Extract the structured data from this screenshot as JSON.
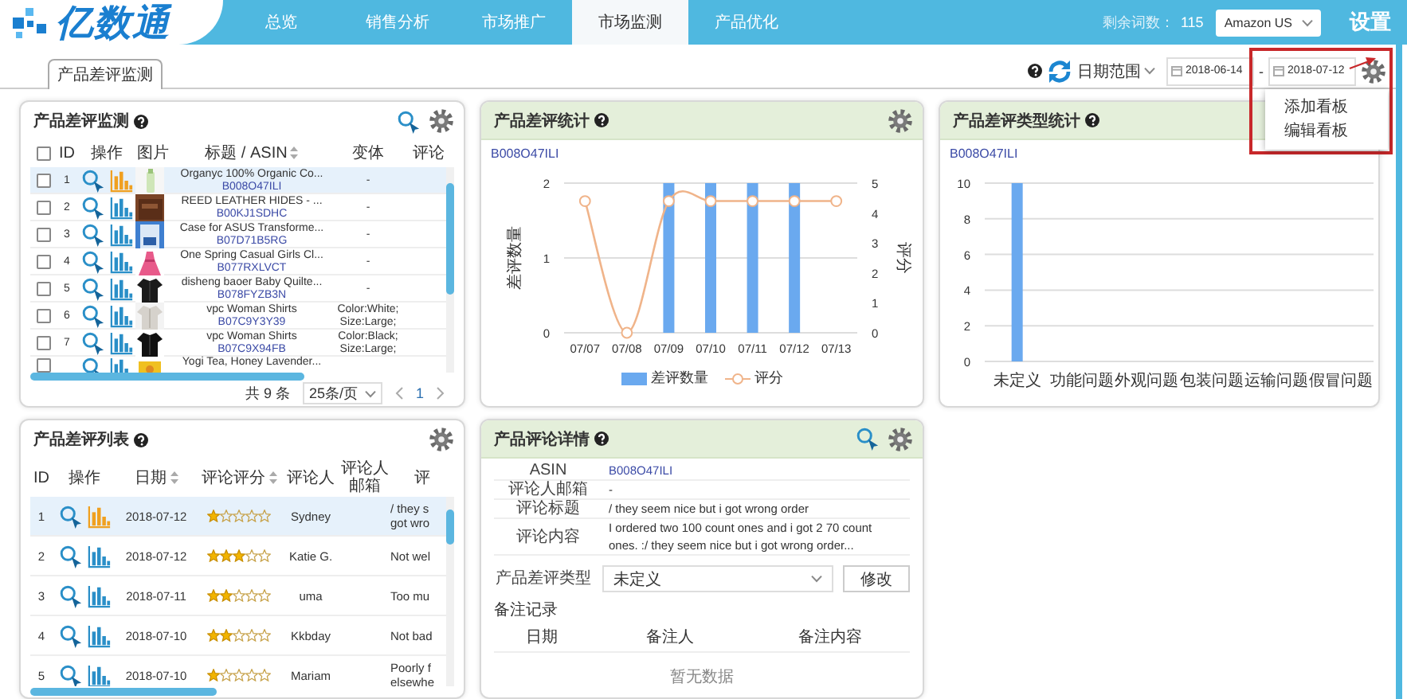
{
  "header": {
    "logo": "亿数通",
    "nav": [
      {
        "label": "总览",
        "selected": false
      },
      {
        "label": "销售分析",
        "selected": false
      },
      {
        "label": "市场推广",
        "selected": false
      },
      {
        "label": "市场监测",
        "selected": true
      },
      {
        "label": "产品优化",
        "selected": false
      }
    ],
    "quota_label": "剩余词数：",
    "quota_value": "115",
    "marketplace": "Amazon US",
    "settings": "设置"
  },
  "toolbar": {
    "tabs": [
      {
        "label": "产品差评监测",
        "selected": true
      }
    ],
    "date_range": "日期范围",
    "start_date": "2018-06-14",
    "separator": "-",
    "end_date": "2018-07-12",
    "menu": {
      "expanded": true,
      "items": [
        "添加看板",
        "编辑看板"
      ]
    }
  },
  "product_monitor": {
    "title": "产品差评监测",
    "all_checked": false,
    "columns": [
      {
        "label": "ID",
        "sortable": false
      },
      {
        "label": "操作",
        "sortable": false
      },
      {
        "label": "图片",
        "sortable": false
      },
      {
        "label": "标题 / ASIN",
        "sortable": true
      },
      {
        "label": "变体",
        "sortable": false
      },
      {
        "label": "评论",
        "sortable": false
      }
    ],
    "rows": [
      {
        "id": "1",
        "title": "Organyc 100% Organic Co...",
        "asin": "B008O47ILI",
        "variant": "-",
        "checked": false,
        "selected": true
      },
      {
        "id": "2",
        "title": "REED LEATHER HIDES - ...",
        "asin": "B00KJ1SDHC",
        "variant": "-",
        "checked": false,
        "selected": false
      },
      {
        "id": "3",
        "title": "Case for ASUS Transforme...",
        "asin": "B07D71B5RG",
        "variant": "-",
        "checked": false,
        "selected": false
      },
      {
        "id": "4",
        "title": "One Spring Casual Girls Cl...",
        "asin": "B077RXLVCT",
        "variant": "-",
        "checked": false,
        "selected": false
      },
      {
        "id": "5",
        "title": "disheng baoer Baby Quilte...",
        "asin": "B078FYZB3N",
        "variant": "-",
        "checked": false,
        "selected": false
      },
      {
        "id": "6",
        "title": "vpc Woman Shirts",
        "asin": "B07C9Y3Y39",
        "variant": "Color:White; Size:Large;",
        "checked": false,
        "selected": false
      },
      {
        "id": "7",
        "title": "vpc Woman Shirts",
        "asin": "B07C9X94FB",
        "variant": "Color:Black; Size:Large;",
        "checked": false,
        "selected": false
      },
      {
        "title": "Yogi Tea, Honey Lavender...",
        "checked": false,
        "selected": false
      }
    ],
    "total": "共 9 条",
    "page_size": "25条/页",
    "page": "1"
  },
  "review_stats": {
    "title": "产品差评统计",
    "asin": "B008O47ILI",
    "chart_data": {
      "type": "bar",
      "ylabel": "差评数量",
      "y2label": "评分",
      "categories": [
        "07/07",
        "07/08",
        "07/09",
        "07/10",
        "07/11",
        "07/12",
        "07/13"
      ],
      "series": [
        {
          "name": "差评数量",
          "color": "#6aa9ef",
          "values": [
            0,
            0,
            2,
            2,
            2,
            2,
            0
          ]
        },
        {
          "name": "评分",
          "type": "line",
          "axis": "y2",
          "marker": true,
          "color": "#f0b48a",
          "values": [
            4.4,
            0,
            4.4,
            4.4,
            4.4,
            4.4,
            4.4
          ]
        }
      ],
      "ylim": [
        0,
        2
      ],
      "yticks": [
        {
          "value": 0,
          "label": "0"
        },
        {
          "value": 1,
          "label": "1"
        },
        {
          "value": 2,
          "label": "2"
        }
      ],
      "y2lim": [
        0,
        5
      ],
      "y2ticks": [
        {
          "value": 0,
          "label": "0"
        },
        {
          "value": 1,
          "label": "1"
        },
        {
          "value": 2,
          "label": "2"
        },
        {
          "value": 3,
          "label": "3"
        },
        {
          "value": 4,
          "label": "4"
        },
        {
          "value": 5,
          "label": "5"
        }
      ],
      "grid": true,
      "legend": "bottom"
    }
  },
  "type_stats": {
    "title": "产品差评类型统计",
    "asin": "B008O47ILI",
    "chart_data": {
      "type": "bar",
      "categories": [
        "未定义",
        "功能问题",
        "外观问题",
        "包装问题",
        "运输问题",
        "假冒问题"
      ],
      "series": [
        {
          "color": "#6aa9ef",
          "values": [
            10,
            0,
            0,
            0,
            0,
            0
          ]
        }
      ],
      "ylim": [
        0,
        10
      ],
      "yticks": [
        {
          "value": 0,
          "label": "0"
        },
        {
          "value": 2,
          "label": "2"
        },
        {
          "value": 4,
          "label": "4"
        },
        {
          "value": 6,
          "label": "6"
        },
        {
          "value": 8,
          "label": "8"
        },
        {
          "value": 10,
          "label": "10"
        }
      ],
      "grid": true
    }
  },
  "review_list": {
    "title": "产品差评列表",
    "columns": [
      {
        "label": "ID",
        "sortable": false
      },
      {
        "label": "操作",
        "sortable": false
      },
      {
        "label": "日期",
        "sortable": true
      },
      {
        "label": "评论评分",
        "sortable": true
      },
      {
        "label": "评论人",
        "sortable": false
      },
      {
        "label": "评论人邮箱",
        "sortable": false
      },
      {
        "label": "评",
        "sortable": false
      }
    ],
    "rows": [
      {
        "id": "1",
        "date": "2018-07-12",
        "stars": 1,
        "reviewer": "Sydney",
        "content": "/ they s\ngot wro",
        "selected": true
      },
      {
        "id": "2",
        "date": "2018-07-12",
        "stars": 3,
        "reviewer": "Katie G.",
        "content": "Not wel",
        "selected": false
      },
      {
        "id": "3",
        "date": "2018-07-11",
        "stars": 2,
        "reviewer": "uma",
        "content": "Too mu",
        "selected": false
      },
      {
        "id": "4",
        "date": "2018-07-10",
        "stars": 2,
        "reviewer": "Kkbday",
        "content": "Not bad",
        "selected": false
      },
      {
        "id": "5",
        "date": "2018-07-10",
        "stars": 1,
        "reviewer": "Mariam",
        "content": "Poorly f\nelsewhe",
        "selected": false
      }
    ]
  },
  "review_detail": {
    "title": "产品评论详情",
    "fields": [
      {
        "label": "ASIN",
        "value": "B008O47ILI",
        "kind": "link"
      },
      {
        "label": "评论人邮箱",
        "value": "-",
        "kind": "text"
      },
      {
        "label": "评论标题",
        "value": "/ they seem nice but i got wrong order",
        "kind": "text"
      },
      {
        "label": "评论内容",
        "value": "I ordered two 100 count ones and i got 2 70 count ones. :/ they seem nice but i got wrong order...",
        "kind": "text"
      }
    ],
    "type_label": "产品差评类型",
    "type_value": "未定义",
    "button": "修改",
    "notes_title": "备注记录",
    "notes_columns": [
      "日期",
      "备注人",
      "备注内容"
    ],
    "empty_text": "暂无数据"
  }
}
